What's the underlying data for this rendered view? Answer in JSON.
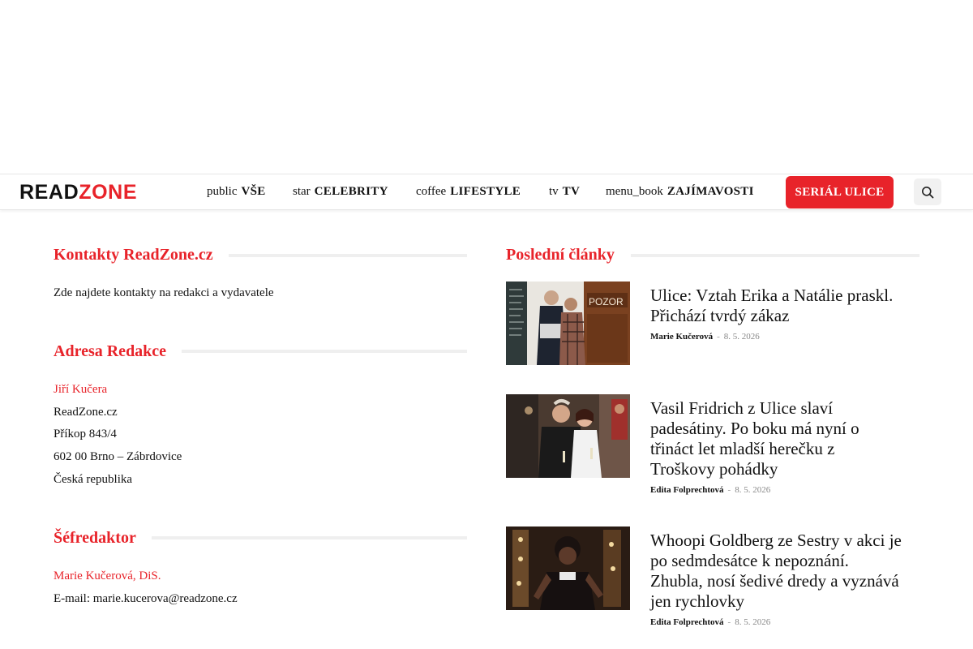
{
  "brand": {
    "logo_part1": "READ",
    "logo_part2": "ZONE",
    "accent_color": "#e8232a"
  },
  "nav": {
    "items": [
      {
        "icon": "public",
        "label": "VŠE"
      },
      {
        "icon": "star",
        "label": "CELEBRITY"
      },
      {
        "icon": "coffee",
        "label": "LIFESTYLE"
      },
      {
        "icon": "tv",
        "label": "TV"
      },
      {
        "icon": "menu_book",
        "label": "ZAJÍMAVOSTI"
      }
    ],
    "cta_label": "SERIÁL ULICE",
    "search_icon": "search-icon"
  },
  "contacts": {
    "title": "Kontakty ReadZone.cz",
    "intro": "Zde najdete kontakty na redakci a vydavatele"
  },
  "address": {
    "title": "Adresa Redakce",
    "name": "Jiří Kučera",
    "lines": [
      "ReadZone.cz",
      "Příkop 843/4",
      "602 00 Brno – Zábrdovice",
      "Česká republika"
    ]
  },
  "editor": {
    "title": "Šéfredaktor",
    "name": "Marie Kučerová, DiS.",
    "email_label": "E-mail:",
    "email": "marie.kucerova@readzone.cz"
  },
  "latest": {
    "title": "Poslední články",
    "articles": [
      {
        "title": "Ulice: Vztah Erika a Natálie praskl. Přichází tvrdý zákaz",
        "author": "Marie Kučerová",
        "separator": "-",
        "date": "8. 5. 2026",
        "thumb_text": "POZOR"
      },
      {
        "title": "Vasil Fridrich z Ulice slaví padesátiny. Po boku má nyní o třináct let mladší herečku z Troškovy pohádky",
        "author": "Edita Folprechtová",
        "separator": "-",
        "date": "8. 5. 2026"
      },
      {
        "title": "Whoopi Goldberg ze Sestry v akci je po sedmdesátce k nepoznání. Zhubla, nosí šedivé dredy a vyznává jen rychlovky",
        "author": "Edita Folprechtová",
        "separator": "-",
        "date": "8. 5. 2026"
      }
    ]
  }
}
